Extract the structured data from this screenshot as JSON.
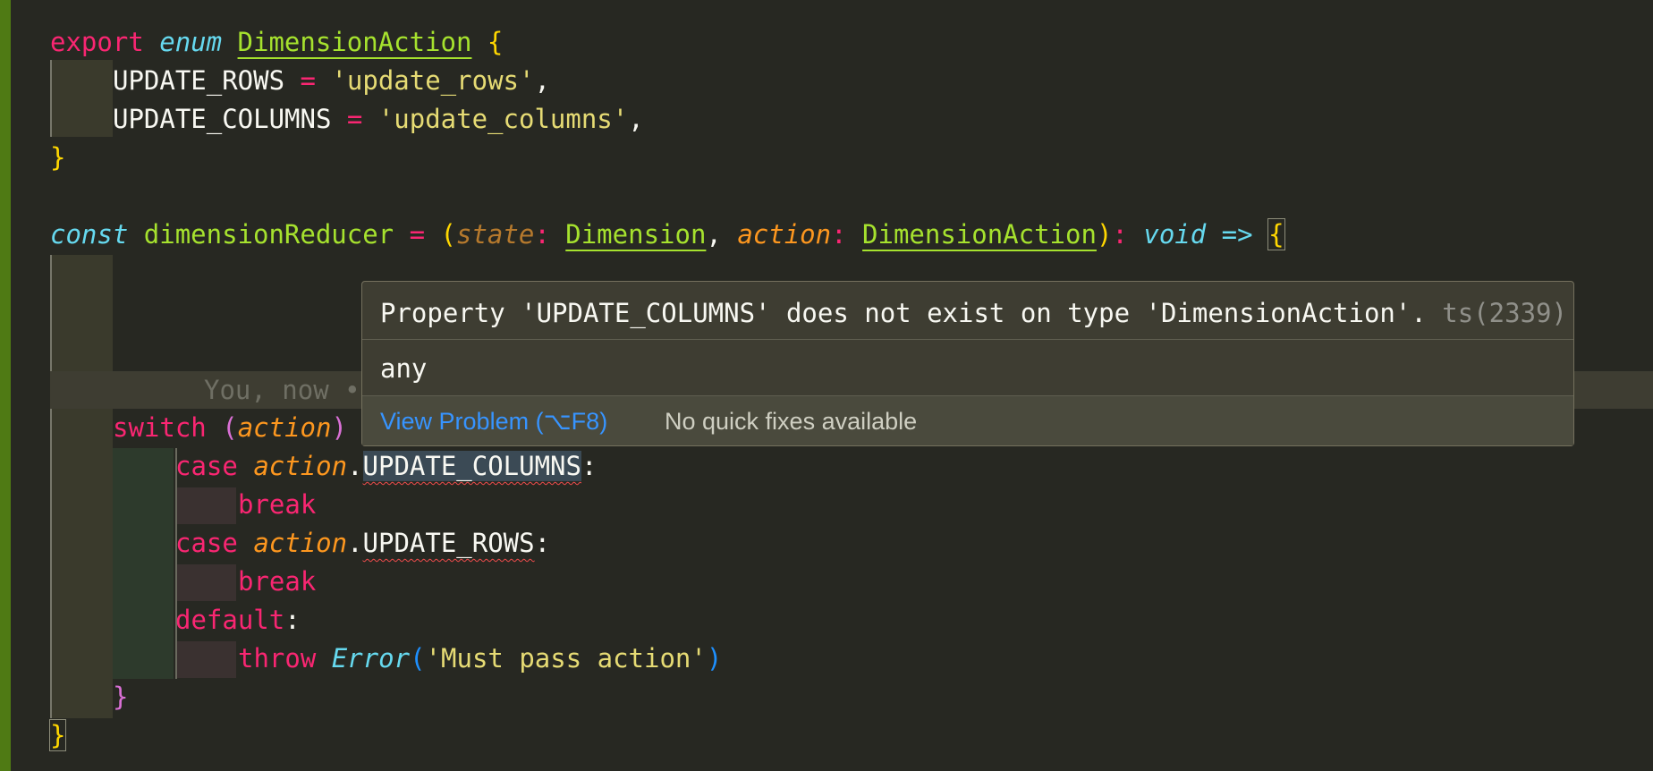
{
  "editor": {
    "enum_line": {
      "export": "export",
      "enum": "enum",
      "name": "DimensionAction",
      "open": "{"
    },
    "enum_members": [
      {
        "name": "UPDATE_ROWS",
        "eq": "=",
        "value": "'update_rows'",
        "comma": ","
      },
      {
        "name": "UPDATE_COLUMNS",
        "eq": "=",
        "value": "'update_columns'",
        "comma": ","
      }
    ],
    "enum_close": "}",
    "reducer": {
      "const": "const",
      "name": "dimensionReducer",
      "eq": "=",
      "open_paren": "(",
      "param1": "state",
      "colon1": ":",
      "type1": "Dimension",
      "comma": ",",
      "param2": "action",
      "colon2": ":",
      "type2": "DimensionAction",
      "close_paren": ")",
      "colon3": ":",
      "ret": "void",
      "arrow": "=>",
      "open": "{"
    },
    "blame": "You, now •",
    "switch": {
      "kw": "switch",
      "open": "(",
      "arg": "action",
      "close": ")"
    },
    "cases": [
      {
        "kw": "case",
        "obj": "action",
        "dot": ".",
        "prop": "UPDATE_COLUMNS",
        "colon": ":",
        "body": "break"
      },
      {
        "kw": "case",
        "obj": "action",
        "dot": ".",
        "prop": "UPDATE_ROWS",
        "colon": ":",
        "body": "break"
      }
    ],
    "default": {
      "kw": "default",
      "colon": ":",
      "throw": "throw",
      "cls": "Error",
      "open": "(",
      "arg": "'Must pass action'",
      "close": ")"
    },
    "switch_close": "}",
    "fn_close": "}"
  },
  "hover": {
    "message": "Property 'UPDATE_COLUMNS' does not exist on type 'DimensionAction'.",
    "code": "ts(2339)",
    "type": "any",
    "view_problem": "View Problem (⌥F8)",
    "no_fixes": "No quick fixes available"
  }
}
